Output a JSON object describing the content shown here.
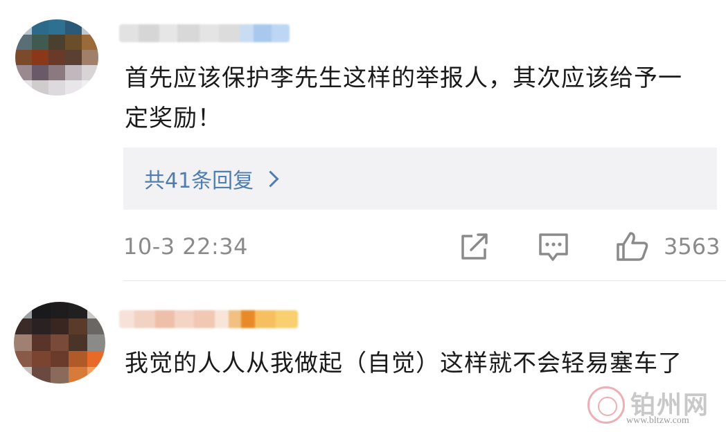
{
  "comments": [
    {
      "text": "首先应该保护李先生这样的举报人，其次应该给予一定奖励！",
      "replies_label": "共41条回复",
      "timestamp": "10-3 22:34",
      "like_count": "3563"
    },
    {
      "text": "我觉的人人从我做起（自觉）这样就不会轻易塞车了"
    }
  ],
  "watermark": {
    "title": "铂州网",
    "url": "www.bltzw.com"
  },
  "colors": {
    "link_blue": "#507daf",
    "meta_gray": "#8a8a8a",
    "reply_bg": "#f2f2f4"
  },
  "icons": [
    "share-icon",
    "comment-icon",
    "thumbs-up-icon",
    "chevron-right-icon"
  ]
}
